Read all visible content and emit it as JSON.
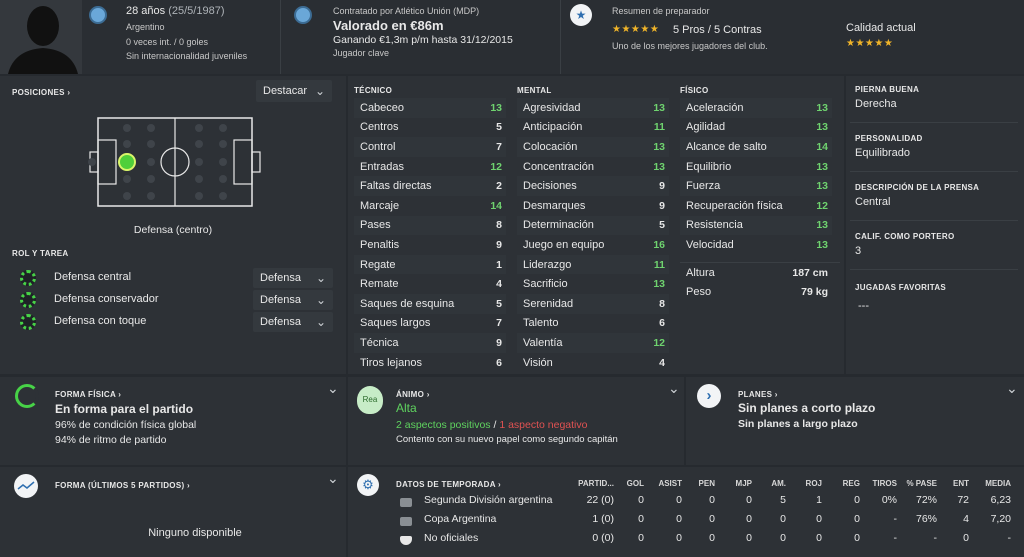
{
  "header": {
    "age": "28 años",
    "dob": "(25/5/1987)",
    "nationality": "Argentino",
    "caps": "0 veces int. / 0 goles",
    "youth_caps": "Sin internacionalidad juveniles",
    "contract_by": "Contratado por Atlético Unión (MDP)",
    "value": "Valorado en €86m",
    "wage": "Ganando €1,3m p/m hasta 31/12/2015",
    "role": "Jugador clave",
    "scout_title": "Resumen de preparador",
    "pros_cons": "5 Pros / 5 Contras",
    "scout_note": "Uno de los mejores jugadores del club.",
    "current_ability_label": "Calidad actual"
  },
  "positions": {
    "title": "POSICIONES",
    "highlight_dropdown": "Destacar",
    "position_label": "Defensa (centro)"
  },
  "roles": {
    "title": "ROL Y TAREA",
    "items": [
      {
        "role": "Defensa central",
        "duty": "Defensa"
      },
      {
        "role": "Defensa conservador",
        "duty": "Defensa"
      },
      {
        "role": "Defensa con toque",
        "duty": "Defensa"
      }
    ]
  },
  "attributes": {
    "technical_title": "TÉCNICO",
    "mental_title": "MENTAL",
    "physical_title": "FÍSICO",
    "technical": [
      {
        "name": "Cabeceo",
        "value": "13"
      },
      {
        "name": "Centros",
        "value": "5"
      },
      {
        "name": "Control",
        "value": "7"
      },
      {
        "name": "Entradas",
        "value": "12"
      },
      {
        "name": "Faltas directas",
        "value": "2"
      },
      {
        "name": "Marcaje",
        "value": "14"
      },
      {
        "name": "Pases",
        "value": "8"
      },
      {
        "name": "Penaltis",
        "value": "9"
      },
      {
        "name": "Regate",
        "value": "1"
      },
      {
        "name": "Remate",
        "value": "4"
      },
      {
        "name": "Saques de esquina",
        "value": "5"
      },
      {
        "name": "Saques largos",
        "value": "7"
      },
      {
        "name": "Técnica",
        "value": "9"
      },
      {
        "name": "Tiros lejanos",
        "value": "6"
      }
    ],
    "mental": [
      {
        "name": "Agresividad",
        "value": "13"
      },
      {
        "name": "Anticipación",
        "value": "11"
      },
      {
        "name": "Colocación",
        "value": "13"
      },
      {
        "name": "Concentración",
        "value": "13"
      },
      {
        "name": "Decisiones",
        "value": "9"
      },
      {
        "name": "Desmarques",
        "value": "9"
      },
      {
        "name": "Determinación",
        "value": "5"
      },
      {
        "name": "Juego en equipo",
        "value": "16"
      },
      {
        "name": "Liderazgo",
        "value": "11"
      },
      {
        "name": "Sacrificio",
        "value": "13"
      },
      {
        "name": "Serenidad",
        "value": "8"
      },
      {
        "name": "Talento",
        "value": "6"
      },
      {
        "name": "Valentía",
        "value": "12"
      },
      {
        "name": "Visión",
        "value": "4"
      }
    ],
    "physical": [
      {
        "name": "Aceleración",
        "value": "13"
      },
      {
        "name": "Agilidad",
        "value": "13"
      },
      {
        "name": "Alcance de salto",
        "value": "14"
      },
      {
        "name": "Equilibrio",
        "value": "13"
      },
      {
        "name": "Fuerza",
        "value": "13"
      },
      {
        "name": "Recuperación física",
        "value": "12"
      },
      {
        "name": "Resistencia",
        "value": "13"
      },
      {
        "name": "Velocidad",
        "value": "13"
      }
    ],
    "height_label": "Altura",
    "height_value": "187 cm",
    "weight_label": "Peso",
    "weight_value": "79 kg"
  },
  "side_info": {
    "foot_title": "PIERNA BUENA",
    "foot_value": "Derecha",
    "personality_title": "PERSONALIDAD",
    "personality_value": "Equilibrado",
    "press_title": "DESCRIPCIÓN DE LA PRENSA",
    "press_value": "Central",
    "gk_title": "CALIF. COMO PORTERO",
    "gk_value": "3",
    "plays_title": "JUGADAS FAVORITAS",
    "plays_value": "---"
  },
  "fitness": {
    "title": "FORMA FÍSICA",
    "status": "En forma para el partido",
    "condition": "96% de condición física global",
    "sharpness": "94% de ritmo de partido"
  },
  "morale": {
    "title": "ÁNIMO",
    "icon_text": "Rea",
    "value": "Alta",
    "positives": "2 aspectos positivos",
    "separator": "/",
    "negatives": "1 aspecto negativo",
    "note": "Contento con su nuevo papel como segundo capitán"
  },
  "plans": {
    "title": "PLANES",
    "short": "Sin planes a corto plazo",
    "long": "Sin planes a largo plazo"
  },
  "form": {
    "title": "FORMA (ÚLTIMOS 5 PARTIDOS)",
    "empty": "Ninguno disponible"
  },
  "season": {
    "title": "DATOS DE TEMPORADA",
    "columns": [
      "PARTID...",
      "GOL",
      "ASIST",
      "PEN",
      "MJP",
      "AM.",
      "ROJ",
      "REG",
      "TIROS",
      "% PASE",
      "ENT",
      "MEDIA"
    ],
    "rows": [
      {
        "name": "Segunda División argentina",
        "cells": [
          "22 (0)",
          "0",
          "0",
          "0",
          "0",
          "5",
          "1",
          "0",
          "0%",
          "72%",
          "72",
          "6,23"
        ]
      },
      {
        "name": "Copa Argentina",
        "cells": [
          "1 (0)",
          "0",
          "0",
          "0",
          "0",
          "0",
          "0",
          "0",
          "-",
          "76%",
          "4",
          "7,20"
        ]
      },
      {
        "name": "No oficiales",
        "cells": [
          "0 (0)",
          "0",
          "0",
          "0",
          "0",
          "0",
          "0",
          "0",
          "-",
          "-",
          "0",
          "-"
        ]
      }
    ]
  }
}
